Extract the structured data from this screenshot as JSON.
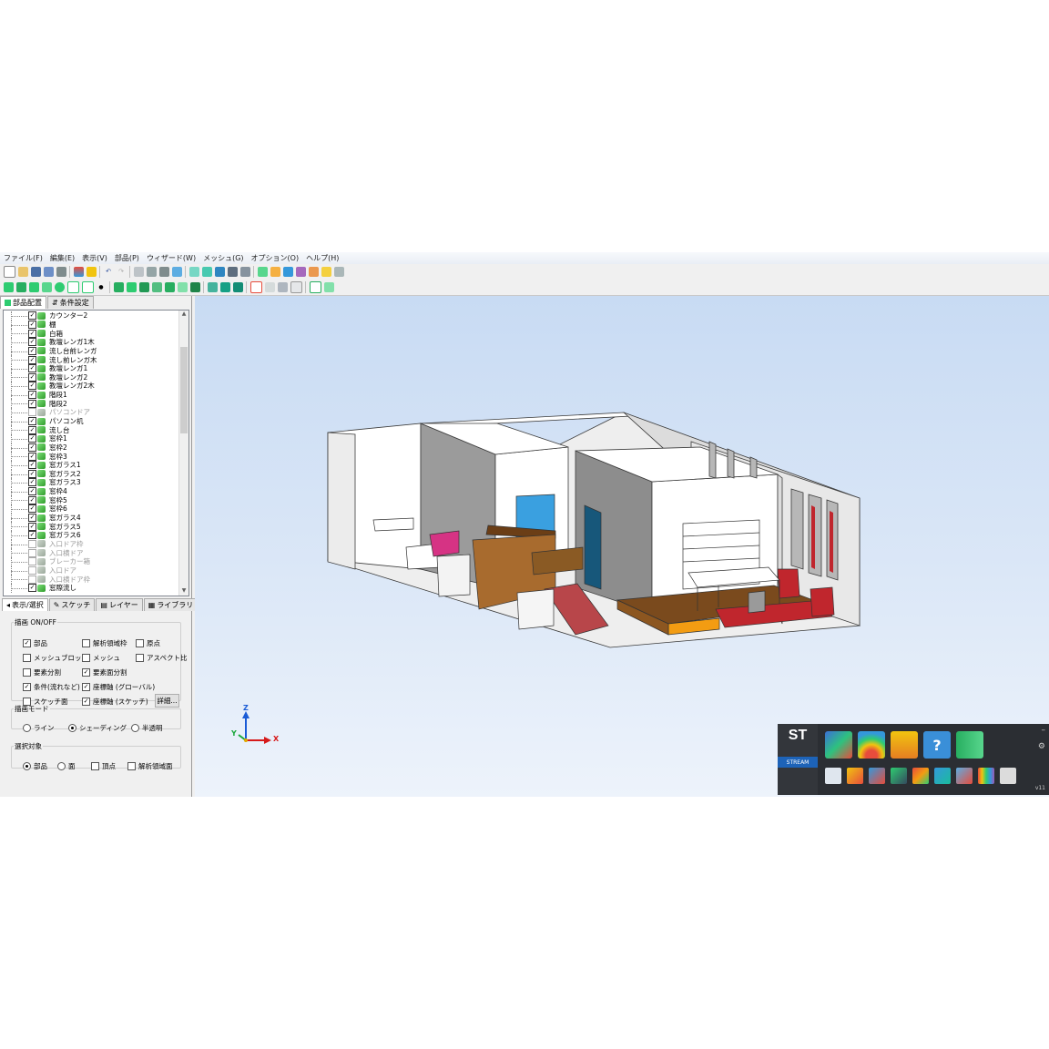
{
  "menubar": {
    "items": [
      "ファイル(F)",
      "編集(E)",
      "表示(V)",
      "部品(P)",
      "ウィザード(W)",
      "メッシュ(G)",
      "オプション(O)",
      "ヘルプ(H)"
    ]
  },
  "left_panel": {
    "top_tabs": [
      "部品配置",
      "条件設定"
    ],
    "tree_items": [
      {
        "label": "カウンター2",
        "checked": true
      },
      {
        "label": "棚",
        "checked": true
      },
      {
        "label": "白箱",
        "checked": true
      },
      {
        "label": "教壇レンガ1木",
        "checked": true
      },
      {
        "label": "流し台前レンガ",
        "checked": true
      },
      {
        "label": "流し前レンガ木",
        "checked": true
      },
      {
        "label": "教壇レンガ1",
        "checked": true
      },
      {
        "label": "教壇レンガ2",
        "checked": true
      },
      {
        "label": "教壇レンガ2木",
        "checked": true
      },
      {
        "label": "階段1",
        "checked": true
      },
      {
        "label": "階段2",
        "checked": true
      },
      {
        "label": "パソコンドア",
        "checked": false
      },
      {
        "label": "パソコン机",
        "checked": true
      },
      {
        "label": "流し台",
        "checked": true
      },
      {
        "label": "窓枠1",
        "checked": true
      },
      {
        "label": "窓枠2",
        "checked": true
      },
      {
        "label": "窓枠3",
        "checked": true
      },
      {
        "label": "窓ガラス1",
        "checked": true
      },
      {
        "label": "窓ガラス2",
        "checked": true
      },
      {
        "label": "窓ガラス3",
        "checked": true
      },
      {
        "label": "窓枠4",
        "checked": true
      },
      {
        "label": "窓枠5",
        "checked": true
      },
      {
        "label": "窓枠6",
        "checked": true
      },
      {
        "label": "窓ガラス4",
        "checked": true
      },
      {
        "label": "窓ガラス5",
        "checked": true
      },
      {
        "label": "窓ガラス6",
        "checked": true
      },
      {
        "label": "入口ドア枠",
        "checked": false
      },
      {
        "label": "入口横ドア",
        "checked": false
      },
      {
        "label": "ブレーカー箱",
        "checked": false
      },
      {
        "label": "入口ドア",
        "checked": false
      },
      {
        "label": "入口横ドア枠",
        "checked": false
      },
      {
        "label": "窓際流し",
        "checked": true
      }
    ],
    "bottom_tabs": [
      "表示/選択",
      "スケッチ",
      "レイヤー",
      "ライブラリ"
    ],
    "draw_onoff": {
      "legend": "描画 ON/OFF",
      "options": [
        {
          "label": "部品",
          "checked": true
        },
        {
          "label": "解析領域枠",
          "checked": false
        },
        {
          "label": "原点",
          "checked": false
        },
        {
          "label": "メッシュブロック",
          "checked": false
        },
        {
          "label": "メッシュ",
          "checked": false
        },
        {
          "label": "アスペクト比",
          "checked": false
        },
        {
          "label": "要素分割",
          "checked": false
        },
        {
          "label": "要素面分割",
          "checked": true
        },
        {
          "label": "条件(流れなど)",
          "checked": true
        },
        {
          "label": "座標軸 (グローバル)",
          "checked": true
        },
        {
          "label": "スケッチ面",
          "checked": false
        },
        {
          "label": "座標軸 (スケッチ)",
          "checked": true
        }
      ],
      "detail_button": "詳細..."
    },
    "draw_mode": {
      "legend": "描画モード",
      "options": [
        {
          "label": "ライン",
          "selected": false
        },
        {
          "label": "シェーディング",
          "selected": true
        },
        {
          "label": "半透明",
          "selected": false
        }
      ]
    },
    "selection_target": {
      "legend": "選択対象",
      "radios": [
        {
          "label": "部品",
          "selected": true
        },
        {
          "label": "面",
          "selected": false
        }
      ],
      "checks": [
        {
          "label": "頂点",
          "checked": false
        },
        {
          "label": "解析領域面",
          "checked": false
        }
      ]
    }
  },
  "viewport": {
    "axis_labels": {
      "z": "Z",
      "x": "X",
      "y": "Y"
    },
    "colors": {
      "floor_orange": "#f39c12",
      "counter_brown": "#a86b2e",
      "door_blue": "#3aa0e0",
      "door_dark": "#17577a",
      "red": "#c0262d",
      "wood": "#7a4a1d"
    }
  },
  "stream_launcher": {
    "logo": "ST",
    "brand": "STREAM",
    "version": "v11",
    "big_icons": [
      "mesh-cube-icon",
      "result-rainbow-icon",
      "brush-tool-icon",
      "help-icon",
      "manual-book-icon"
    ],
    "small_icons": [
      "save-icon",
      "tool1-icon",
      "tool2-icon",
      "tool3-icon",
      "tool4-icon",
      "tool5-icon",
      "tool6-icon",
      "tool7-icon",
      "tool8-icon"
    ]
  }
}
